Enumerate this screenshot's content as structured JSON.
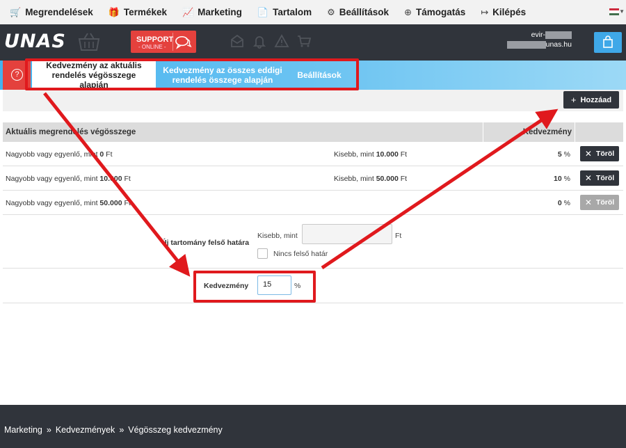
{
  "topmenu": {
    "items": [
      {
        "icon": "cart-icon",
        "glyph": "🛒",
        "label": "Megrendelések"
      },
      {
        "icon": "gift-icon",
        "glyph": "🎁",
        "label": "Termékek"
      },
      {
        "icon": "chart-icon",
        "glyph": "📈",
        "label": "Marketing"
      },
      {
        "icon": "document-icon",
        "glyph": "📄",
        "label": "Tartalom"
      },
      {
        "icon": "gear-icon",
        "glyph": "⚙",
        "label": "Beállítások"
      },
      {
        "icon": "lifebuoy-icon",
        "glyph": "⊕",
        "label": "Támogatás"
      },
      {
        "icon": "logout-icon",
        "glyph": "↦",
        "label": "Kilépés"
      }
    ],
    "language_flag_colors": [
      "#cd2a3e",
      "#ffffff",
      "#436f4d"
    ]
  },
  "header": {
    "logo": "UNAS",
    "support_title": "SUPPORT",
    "support_status": "- ONLINE -",
    "shop_name_prefix": "evir-",
    "shop_domain_suffix": "unas.hu",
    "accent_color": "#3fa8e8",
    "support_color": "#e4413d"
  },
  "tabs": [
    {
      "label": "Kedvezmény az aktuális rendelés végösszege alapján",
      "active": true
    },
    {
      "label": "Kedvezmény az összes eddigi rendelés összege alapján",
      "active": false
    },
    {
      "label": "Beállítások",
      "active": false
    }
  ],
  "toolbar": {
    "add_label": "Hozzáad"
  },
  "table": {
    "headers": {
      "range": "Aktuális megrendelés végösszege",
      "discount": "Kedvezmény"
    },
    "rows": [
      {
        "lower_prefix": "Nagyobb vagy egyenlő, mint ",
        "lower_value": "0",
        "lower_unit": " Ft",
        "upper_prefix": "Kisebb, mint ",
        "upper_value": "10.000",
        "upper_unit": " Ft",
        "discount": "5",
        "delete_label": "Töröl",
        "delete_enabled": true
      },
      {
        "lower_prefix": "Nagyobb vagy egyenlő, mint ",
        "lower_value": "10.000",
        "lower_unit": " Ft",
        "upper_prefix": "Kisebb, mint ",
        "upper_value": "50.000",
        "upper_unit": " Ft",
        "discount": "10",
        "delete_label": "Töröl",
        "delete_enabled": true
      },
      {
        "lower_prefix": "Nagyobb vagy egyenlő, mint ",
        "lower_value": "50.000",
        "lower_unit": " Ft",
        "upper_prefix": "",
        "upper_value": "",
        "upper_unit": "",
        "discount": "0",
        "delete_label": "Töröl",
        "delete_enabled": false
      }
    ],
    "percent_sign": " %"
  },
  "new_range": {
    "upper_label": "Új tartomány felső határa",
    "kisebb_label": "Kisebb, mint",
    "upper_value": "",
    "currency": "Ft",
    "no_upper_label": "Nincs felső határ",
    "no_upper_checked": false,
    "discount_label": "Kedvezmény",
    "discount_value": "15",
    "percent_unit": "%"
  },
  "footer": {
    "breadcrumb": [
      "Marketing",
      "Kedvezmények",
      "Végösszeg kedvezmény"
    ],
    "separator": "»"
  },
  "annotation_color": "#e0191d"
}
